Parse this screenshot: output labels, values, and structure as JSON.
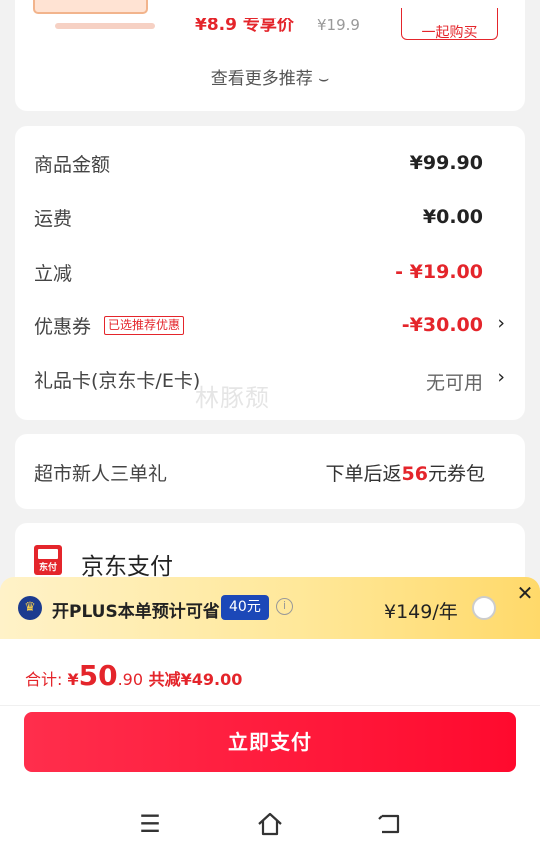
{
  "recommend": {
    "price": "¥8.9 专享价",
    "old_price": "¥19.9",
    "button": "一起购买",
    "more": "查看更多推荐 ⌣"
  },
  "amounts": {
    "rows": [
      {
        "label": "商品金额",
        "value": "¥99.90"
      },
      {
        "label": "运费",
        "value": "¥0.00"
      },
      {
        "label": "立减",
        "value": "- ¥19.00"
      },
      {
        "label": "优惠券",
        "tag": "已选推荐优惠",
        "value": "-¥30.00"
      },
      {
        "label": "礼品卡(京东卡/E卡)",
        "value": "无可用"
      }
    ],
    "chevron": "›"
  },
  "watermark": "林豚颓",
  "gift": {
    "label": "超市新人三单礼",
    "prefix": "下单后返",
    "amount": "56",
    "suffix": "元券包"
  },
  "payment": {
    "icon_text": "东付",
    "label": "京东支付"
  },
  "plus": {
    "text": "开PLUS本单预计可省",
    "badge": "40元",
    "price": "¥149/年",
    "close": "✕"
  },
  "total": {
    "label": "合计: ",
    "currency": "¥",
    "big": "50",
    "cents": ".90",
    "saved": " 共减¥49.00"
  },
  "pay_button": "立即支付",
  "colors": {
    "accent": "#e4252b",
    "plus_blue": "#1c48b8"
  }
}
